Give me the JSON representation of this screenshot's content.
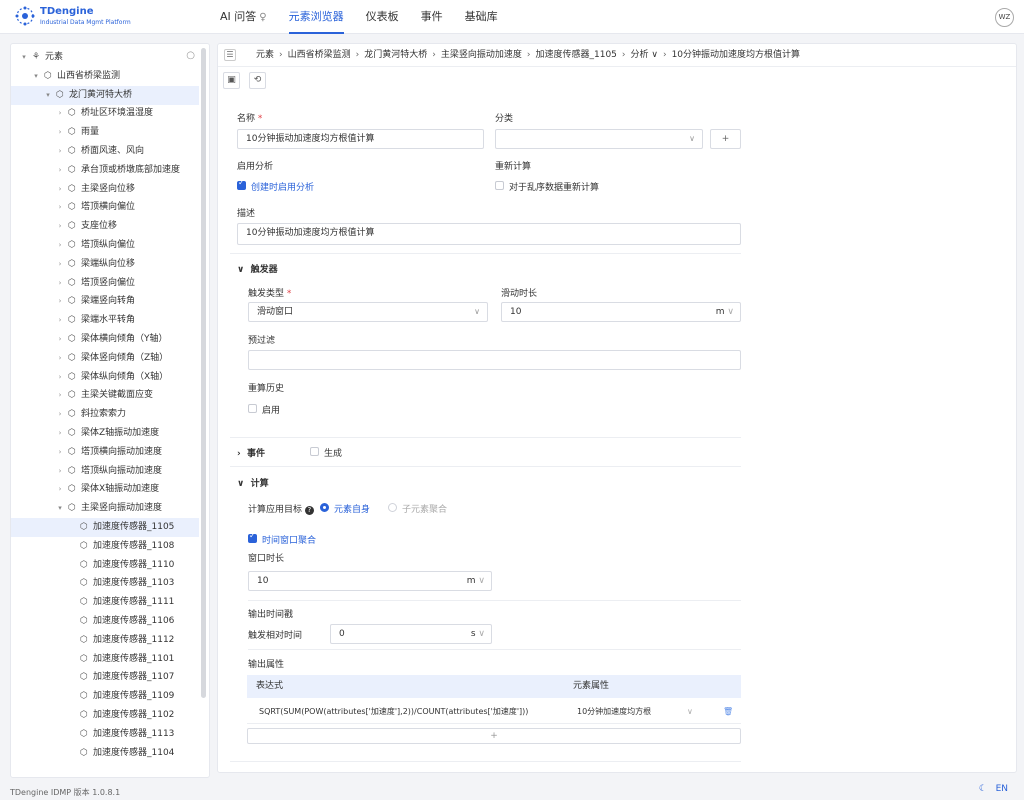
{
  "app": {
    "name": "TDengine",
    "subtitle": "Industrial Data Mgmt Platform",
    "user_initials": "WZ"
  },
  "nav": [
    {
      "label": "AI 问答",
      "icon": "bulb-icon"
    },
    {
      "label": "元素浏览器",
      "active": true
    },
    {
      "label": "仪表板"
    },
    {
      "label": "事件"
    },
    {
      "label": "基础库"
    }
  ],
  "sidebar": {
    "root": "元素",
    "level1": "山西省桥梁监测",
    "level2": "龙门黄河特大桥",
    "items": [
      "桥址区环境温湿度",
      "雨量",
      "桥面风速、风向",
      "承台顶或桥墩底部加速度",
      "主梁竖向位移",
      "塔顶横向偏位",
      "支座位移",
      "塔顶纵向偏位",
      "梁端纵向位移",
      "塔顶竖向偏位",
      "梁端竖向转角",
      "梁端水平转角",
      "梁体横向倾角（Y轴）",
      "梁体竖向倾角（Z轴）",
      "梁体纵向倾角（X轴）",
      "主梁关键截面应变",
      "斜拉索索力",
      "梁体Z轴振动加速度",
      "塔顶横向振动加速度",
      "塔顶纵向振动加速度",
      "梁体X轴振动加速度",
      "主梁竖向振动加速度"
    ],
    "sensors": [
      "加速度传感器_1105",
      "加速度传感器_1108",
      "加速度传感器_1110",
      "加速度传感器_1103",
      "加速度传感器_1111",
      "加速度传感器_1106",
      "加速度传感器_1112",
      "加速度传感器_1101",
      "加速度传感器_1107",
      "加速度传感器_1109",
      "加速度传感器_1102",
      "加速度传感器_1113",
      "加速度传感器_1104"
    ],
    "selected": "加速度传感器_1105"
  },
  "breadcrumb": [
    "元素",
    "山西省桥梁监测",
    "龙门黄河特大桥",
    "主梁竖向振动加速度",
    "加速度传感器_1105",
    "分析 ∨",
    "10分钟振动加速度均方根值计算"
  ],
  "form": {
    "name_label": "名称",
    "name_value": "10分钟振动加速度均方根值计算",
    "category_label": "分类",
    "category_value": "",
    "enable_label": "启用分析",
    "enable_checkbox": "创建时启用分析",
    "recalc_label": "重新计算",
    "recalc_checkbox": "对于乱序数据重新计算",
    "desc_label": "描述",
    "desc_value": "10分钟振动加速度均方根值计算"
  },
  "trigger": {
    "title": "触发器",
    "type_label": "触发类型",
    "type_value": "滑动窗口",
    "slide_label": "滑动时长",
    "slide_value": "10",
    "slide_unit": "m",
    "prefilter_label": "预过滤",
    "prefilter_value": "",
    "recalc_history_label": "重算历史",
    "enable_checkbox": "启用"
  },
  "event": {
    "title": "事件",
    "generate_checkbox": "生成"
  },
  "compute": {
    "title": "计算",
    "target_label": "计算应用目标",
    "target_self": "元素自身",
    "target_children": "子元素聚合",
    "window_agg_checkbox": "时间窗口聚合",
    "window_label": "窗口时长",
    "window_value": "10",
    "window_unit": "m",
    "output_ts_label": "输出时间戳",
    "trigger_offset_label": "触发相对时间",
    "trigger_offset_value": "0",
    "trigger_offset_unit": "s",
    "output_attr_label": "输出属性",
    "table_headers": [
      "表达式",
      "元素属性"
    ],
    "rows": [
      {
        "expression": "SQRT(SUM(POW(attributes['加速度'],2))/COUNT(attributes['加速度']))",
        "attribute": "10分钟加速度均方根"
      }
    ],
    "add_label": "+"
  },
  "footer": {
    "version": "TDengine IDMP 版本 1.0.8.1",
    "lang": "EN"
  }
}
